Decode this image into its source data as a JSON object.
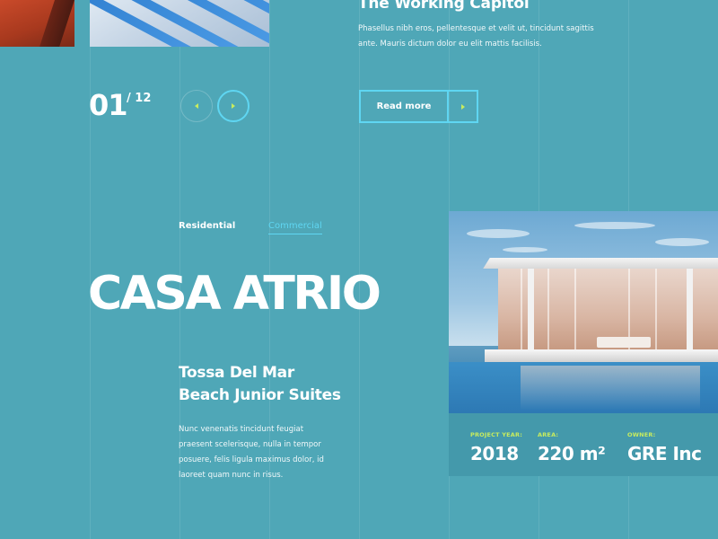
{
  "top_section": {
    "title": "The Working Capitol",
    "description": "Phasellus nibh eros, pellentesque et velit ut, tincidunt sagittis ante. Mauris dictum dolor eu elit mattis facilisis.",
    "read_more_label": "Read more"
  },
  "slider": {
    "current": "01",
    "total": "/ 12"
  },
  "tabs": [
    {
      "label": "Residential",
      "active": false
    },
    {
      "label": "Commercial",
      "active": true
    }
  ],
  "project": {
    "title": "CASA ATRIO",
    "subtitle_line1": "Tossa Del Mar",
    "subtitle_line2": "Beach Junior Suites",
    "description": "Nunc venenatis tincidunt feugiat praesent scelerisque, nulla in tempor posuere, felis ligula maximus dolor, id laoreet quam nunc in risus."
  },
  "stats": [
    {
      "key": "PROJECT YEAR:",
      "value": "2018"
    },
    {
      "key": "AREA:",
      "value": "220 m²"
    },
    {
      "key": "OWNER:",
      "value": "GRE Inc"
    }
  ],
  "colors": {
    "background": "#4fa7b7",
    "accent_cyan": "#5fd6f2",
    "accent_lime": "#c8ec5e",
    "stats_panel": "#4499ab"
  },
  "icons": {
    "prev": "triangle-left-icon",
    "next": "triangle-right-icon",
    "read_more_arrow": "triangle-right-icon"
  }
}
